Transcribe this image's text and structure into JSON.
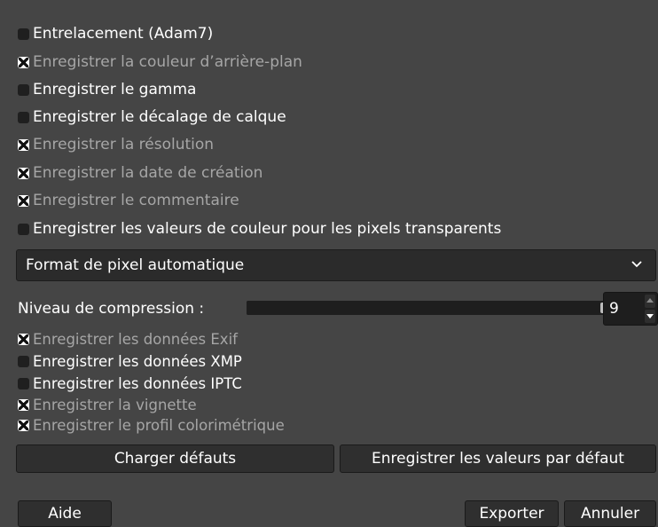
{
  "options_top": [
    {
      "label": "Entrelacement (Adam7)",
      "checked": false
    },
    {
      "label": "Enregistrer la couleur d’arrière-plan",
      "checked": true
    },
    {
      "label": "Enregistrer le gamma",
      "checked": false
    },
    {
      "label": "Enregistrer le décalage de calque",
      "checked": false
    },
    {
      "label": "Enregistrer la résolution",
      "checked": true
    },
    {
      "label": "Enregistrer la date de création",
      "checked": true
    },
    {
      "label": "Enregistrer le commentaire",
      "checked": true
    },
    {
      "label": "Enregistrer les valeurs de couleur pour les pixels transparents",
      "checked": false
    }
  ],
  "pixel_format": {
    "selected": "Format de pixel automatique",
    "icon": "chevron-down-icon"
  },
  "compression": {
    "label": "Niveau de compression :",
    "value": "9",
    "level_fraction": 1.0
  },
  "options_meta": [
    {
      "label": "Enregistrer les données Exif",
      "checked": true
    },
    {
      "label": "Enregistrer les données XMP",
      "checked": false
    },
    {
      "label": "Enregistrer les données IPTC",
      "checked": false
    },
    {
      "label": "Enregistrer la vignette",
      "checked": true
    },
    {
      "label": "Enregistrer le profil colorimétrique",
      "checked": true
    }
  ],
  "defaults": {
    "load_label": "Charger défauts",
    "save_label": "Enregistrer les valeurs par défaut"
  },
  "footer": {
    "help_label": "Aide",
    "export_label": "Exporter",
    "cancel_label": "Annuler"
  },
  "colors": {
    "background": "#454545",
    "control_dark": "#1e1e1e",
    "text_enabled": "#ffffff",
    "text_disabled": "#a6a6a6"
  }
}
